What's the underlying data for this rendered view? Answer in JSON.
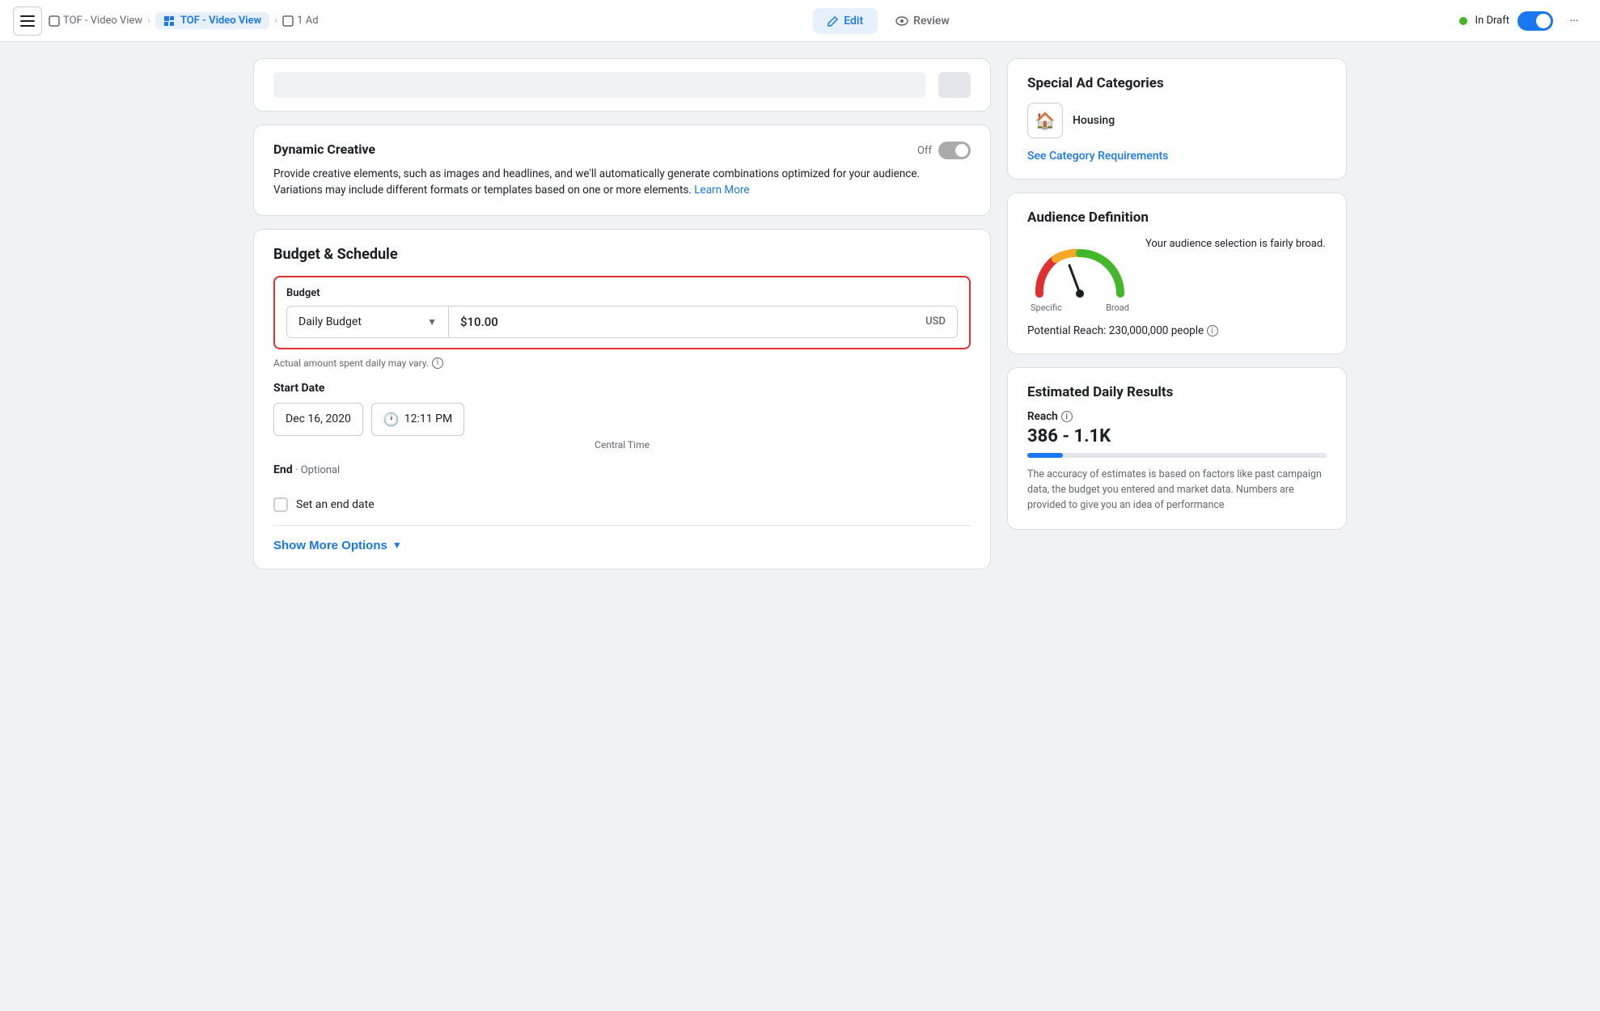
{
  "nav": {
    "breadcrumb": [
      {
        "label": "TOF - Video View",
        "active": false
      },
      {
        "label": "TOF - Video View",
        "active": true
      },
      {
        "label": "1 Ad",
        "active": false
      }
    ],
    "tabs": [
      {
        "label": "Edit",
        "active": true
      },
      {
        "label": "Review",
        "active": false
      }
    ],
    "status": "In Draft",
    "more_icon": "···"
  },
  "dynamic_creative": {
    "title": "Dynamic Creative",
    "toggle_label": "Off",
    "body": "Provide creative elements, such as images and headlines, and we'll automatically generate combinations optimized for your audience. Variations may include different formats or templates based on one or more elements.",
    "learn_more": "Learn More"
  },
  "budget_schedule": {
    "section_title": "Budget & Schedule",
    "budget_label": "Budget",
    "budget_type": "Daily Budget",
    "budget_amount": "$10.00",
    "budget_currency": "USD",
    "budget_note": "Actual amount spent daily may vary.",
    "start_date_label": "Start Date",
    "start_date": "Dec 16, 2020",
    "start_time": "12:11 PM",
    "timezone": "Central Time",
    "end_label": "End",
    "end_optional": "· Optional",
    "end_date_placeholder": "Set an end date",
    "show_more": "Show More Options"
  },
  "special_ad_categories": {
    "title": "Special Ad Categories",
    "category": "Housing",
    "see_requirements": "See Category Requirements"
  },
  "audience_definition": {
    "title": "Audience Definition",
    "description": "Your audience selection is fairly broad.",
    "specific_label": "Specific",
    "broad_label": "Broad",
    "potential_reach": "Potential Reach: 230,000,000 people"
  },
  "estimated_results": {
    "title": "Estimated Daily Results",
    "reach_label": "Reach",
    "reach_value": "386 - 1.1K",
    "note": "The accuracy of estimates is based on factors like past campaign data, the budget you entered and market data. Numbers are provided to give you an idea of performance"
  }
}
